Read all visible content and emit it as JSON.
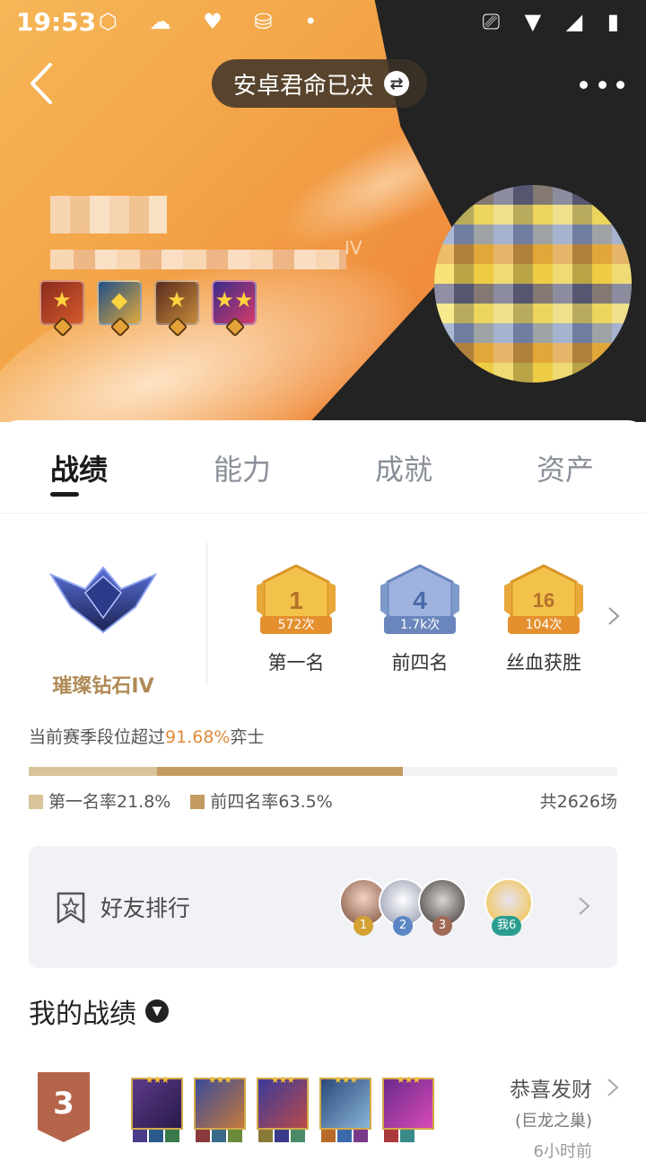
{
  "status_bar": {
    "time": "19:53"
  },
  "header": {
    "title": "安卓君命已决",
    "rank_suffix": "IV"
  },
  "tabs": [
    {
      "label": "战绩",
      "active": true
    },
    {
      "label": "能力",
      "active": false
    },
    {
      "label": "成就",
      "active": false
    },
    {
      "label": "资产",
      "active": false
    }
  ],
  "rank": {
    "name": "璀璨钻石IV"
  },
  "stats": [
    {
      "icon": "1",
      "count": "572次",
      "label": "第一名",
      "color": "#e8b43a"
    },
    {
      "icon": "4",
      "count": "1.7k次",
      "label": "前四名",
      "color": "#7d9ac8"
    },
    {
      "icon": "16",
      "count": "104次",
      "label": "丝血获胜",
      "color": "#e8b43a"
    }
  ],
  "percentile": {
    "prefix": "当前赛季段位超过",
    "value": "91.68%",
    "suffix": "弈士"
  },
  "rates": {
    "first_label": "第一名率21.8%",
    "top4_label": "前四名率63.5%",
    "first_rate": 0.218,
    "top4_rate": 0.635,
    "total": "共2626场"
  },
  "friends": {
    "title": "好友排行",
    "ranks": [
      "1",
      "2",
      "3"
    ],
    "me": "我6"
  },
  "records": {
    "title": "我的战绩",
    "match": {
      "place": "3",
      "mode_name": "恭喜发财",
      "map": "(巨龙之巢)",
      "time": "6小时前"
    }
  },
  "colors": {
    "accent": "#e08a3c",
    "rank_gold": "#b08a56",
    "bar_first": "#d9c39a",
    "bar_top4": "#c49a63"
  }
}
